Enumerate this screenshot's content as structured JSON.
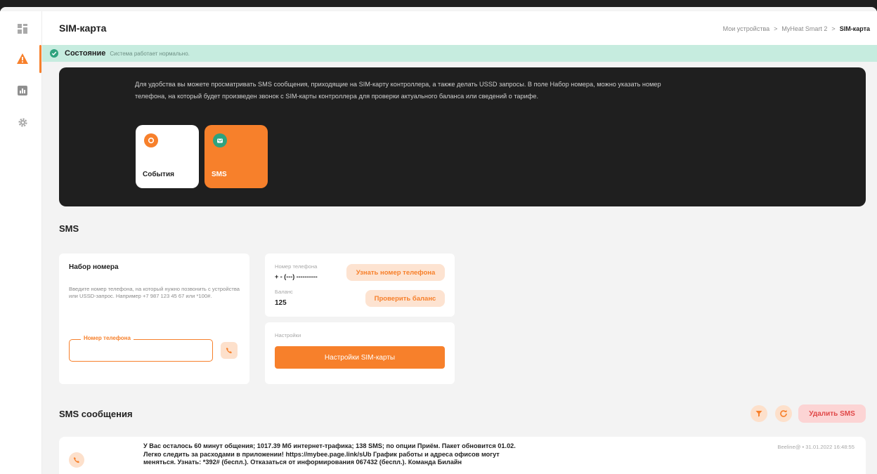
{
  "header": {
    "title": "SIM-карта",
    "breadcrumb": [
      "Мои устройства",
      "MyHeat Smart 2",
      "SIM-карта"
    ],
    "separator": ">"
  },
  "sidebar": {
    "items": [
      {
        "icon": "dashboard-icon"
      },
      {
        "icon": "warning-icon",
        "active": true
      },
      {
        "icon": "bar-chart-icon"
      },
      {
        "icon": "gear-icon"
      }
    ]
  },
  "status": {
    "title": "Состояние",
    "text": "Система работает нормально."
  },
  "hero": {
    "text": "Для удобства вы можете просматривать SMS сообщения, приходящие на SIM-карту контроллера, а также делать USSD запросы. В поле Набор номера, можно указать номер телефона, на который будет произведен звонок с SIM-карты контроллера для проверки актуального баланса или сведений о тарифе.",
    "cards": [
      {
        "label": "События",
        "icon": "bell-icon",
        "active": false
      },
      {
        "label": "SMS",
        "icon": "message-icon",
        "active": true
      }
    ]
  },
  "sms_section": {
    "heading": "SMS",
    "dial": {
      "title": "Набор номера",
      "description": "Введите номер телефона, на который нужно позвонить с устройства или USSD-запрос. Например +7 987 123 45 67 или *100#.",
      "phone_label": "Номер телефона",
      "phone_value": ""
    },
    "info": {
      "phone_label": "Номер телефона",
      "phone_value": "+ - (---) ----------",
      "find_phone_btn": "Узнать номер телефона",
      "balance_label": "Баланс",
      "balance_value": "125",
      "check_balance_btn": "Проверить баланс"
    },
    "settings": {
      "label": "Настройки",
      "button": "Настройки SIM-карты"
    }
  },
  "messages": {
    "heading": "SMS сообщения",
    "delete_btn": "Удалить SMS",
    "items": [
      {
        "text": "У Вас осталось 60 минут общения; 1017.39 Мб интернет-трафика; 138 SMS; по опции Приём. Пакет обновится 01.02. Легко следить за расходами в приложении! https://mybee.page.link/sUb График работы и адреса офисов могут меняться. Узнать: *392# (беспл.). Отказаться от информирования 067432 (беспл.). Команда Билайн",
        "meta": "Beeline@ • 31.01.2022 16:48:55"
      }
    ]
  },
  "colors": {
    "accent": "#f7802b",
    "status_bg": "#c6ecdf",
    "dark": "#1f1f1f",
    "delete": "#e04848"
  }
}
